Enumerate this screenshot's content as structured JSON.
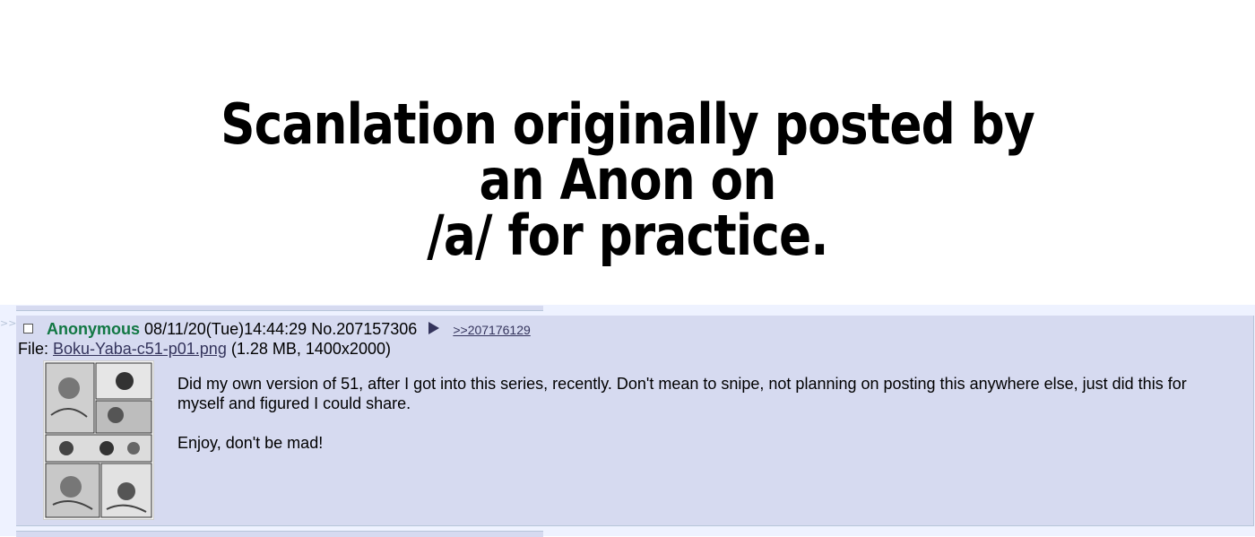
{
  "banner": {
    "line1": "Scanlation originally posted by an Anon on",
    "line2": "/a/ for practice."
  },
  "side": {
    "arrows": ">>"
  },
  "post": {
    "name": "Anonymous",
    "datetime": "08/11/20(Tue)14:44:29",
    "post_no": "No.207157306",
    "backlink": ">>207176129",
    "file": {
      "label": "File:",
      "filename": "Boku-Yaba-c51-p01.png",
      "meta": "(1.28 MB, 1400x2000)"
    },
    "thumbnail_icon": "manga-page-thumbnail",
    "message": [
      "Did my own version of 51, after I got into this series, recently. Don't mean to snipe, not planning on posting this anywhere else, just did this for myself and figured I could share.",
      "Enjoy, don't be mad!"
    ]
  },
  "colors": {
    "post_bg": "#d6daf0",
    "board_bg": "#eef2ff",
    "name_green": "#117743",
    "link_blue": "#34345c"
  }
}
